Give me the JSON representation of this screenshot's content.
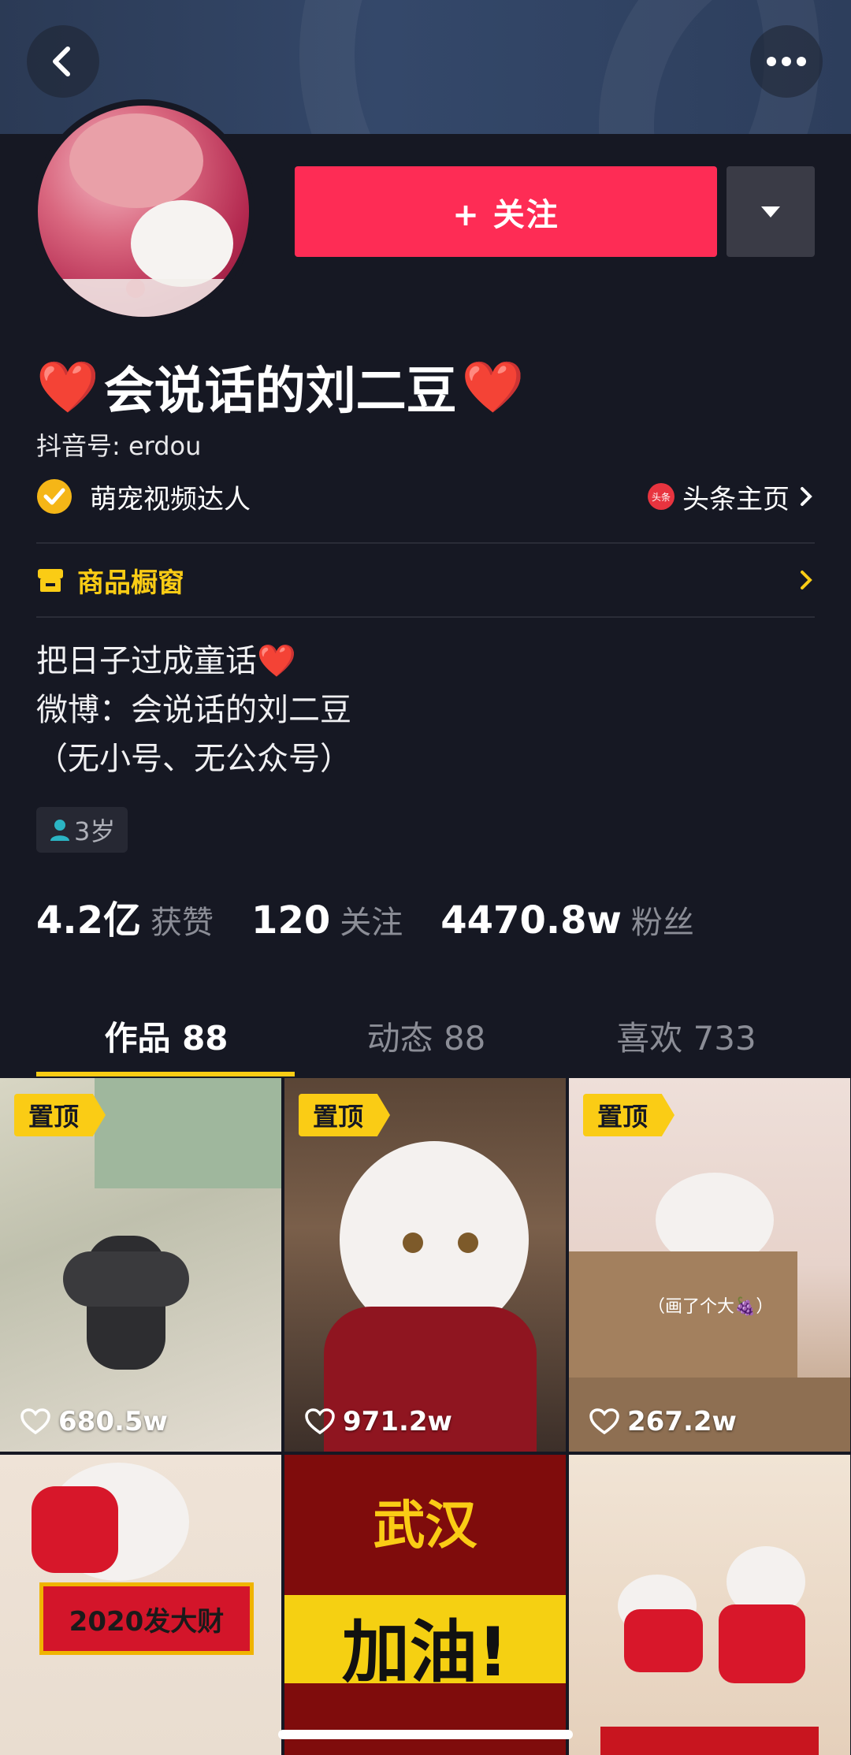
{
  "header": {
    "back_icon": "chevron-left-icon",
    "more_icon": "ellipsis-icon"
  },
  "profile": {
    "follow_label": "+ 关注",
    "nickname": "会说话的刘二豆",
    "nickname_decoration": "❤️",
    "douyin_id": "抖音号: erdou",
    "verified_label": "萌宠视频达人",
    "toutiao_label": "头条主页",
    "toutiao_badge": "头条",
    "shop_label": "商品橱窗",
    "bio_lines": [
      "把日子过成童话❤️",
      "微博：会说话的刘二豆",
      "（无小号、无公众号）"
    ],
    "age_tag": "3岁"
  },
  "stats": [
    {
      "value": "4.2亿",
      "label": "获赞"
    },
    {
      "value": "120",
      "label": "关注"
    },
    {
      "value": "4470.8w",
      "label": "粉丝"
    }
  ],
  "tabs": [
    {
      "label": "作品 88",
      "active": true
    },
    {
      "label": "动态 88",
      "active": false
    },
    {
      "label": "喜欢 733",
      "active": false
    }
  ],
  "videos": [
    {
      "pinned": "置顶",
      "likes": "680.5w"
    },
    {
      "pinned": "置顶",
      "likes": "971.2w"
    },
    {
      "pinned": "置顶",
      "likes": "267.2w",
      "caption": "（画了个大🍇）"
    },
    {
      "banner_text": "2020发大财"
    },
    {
      "line1": "武汉",
      "line2": "加油!"
    },
    {}
  ],
  "colors": {
    "accent": "#fe2c55",
    "highlight": "#facc15",
    "background": "#161823"
  }
}
